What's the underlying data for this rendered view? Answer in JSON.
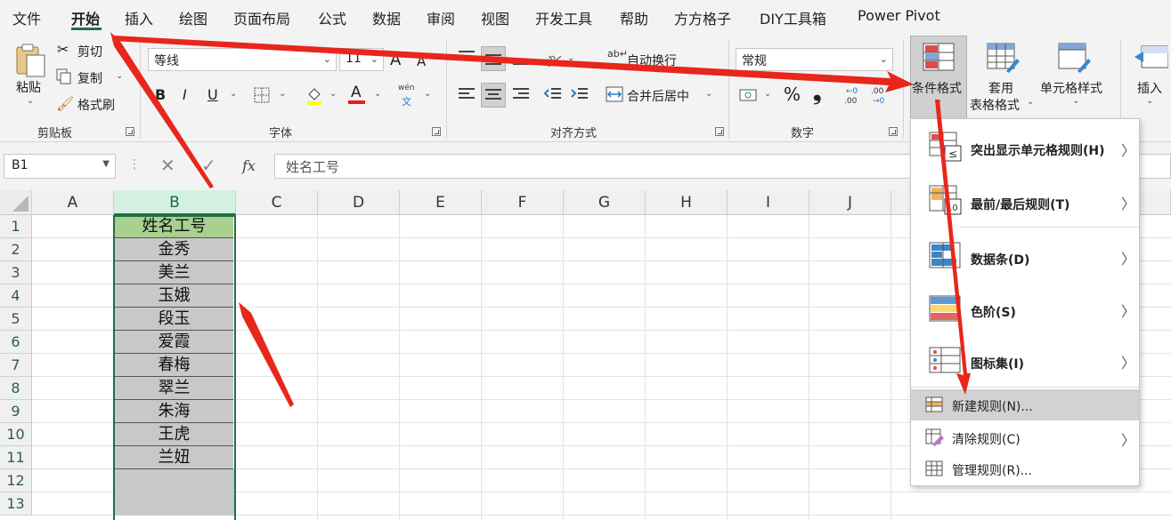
{
  "menu_tabs": [
    "文件",
    "开始",
    "插入",
    "绘图",
    "页面布局",
    "公式",
    "数据",
    "审阅",
    "视图",
    "开发工具",
    "帮助",
    "方方格子",
    "DIY工具箱",
    "Power Pivot"
  ],
  "active_tab": "开始",
  "clipboard": {
    "paste_label": "粘贴",
    "cut_label": "剪切",
    "copy_label": "复制",
    "format_painter_label": "格式刷",
    "group_label": "剪贴板"
  },
  "font": {
    "family": "等线",
    "size": "11",
    "bold": "B",
    "italic": "I",
    "underline": "U",
    "grow": "A",
    "shrink": "A",
    "font_color_glyph": "A",
    "phonetic_top": "wén",
    "phonetic_bottom": "文",
    "group_label": "字体"
  },
  "alignment": {
    "wrap_text_label": "自动换行",
    "merge_label": "合并后居中",
    "group_label": "对齐方式"
  },
  "number": {
    "format": "常规",
    "percent": "%",
    "comma": "❟",
    "group_label": "数字"
  },
  "styles": {
    "conditional_format_label": "条件格式",
    "table_format_label_1": "套用",
    "table_format_label_2": "表格格式",
    "cell_styles_label": "单元格样式"
  },
  "cells": {
    "insert_label": "插入"
  },
  "formula_bar": {
    "name_box": "B1",
    "formula": "姓名工号",
    "fx": "fx"
  },
  "columns": [
    "A",
    "B",
    "C",
    "D",
    "E",
    "F",
    "G",
    "H",
    "I",
    "J"
  ],
  "selected_column": "B",
  "rows": [
    "1",
    "2",
    "3",
    "4",
    "5",
    "6",
    "7",
    "8",
    "9",
    "10",
    "11",
    "12",
    "13"
  ],
  "column_b": [
    "姓名工号",
    "金秀",
    "美兰",
    "玉娥",
    "段玉",
    "爱霞",
    "春梅",
    "翠兰",
    "朱海",
    "王虎",
    "兰妞",
    "",
    ""
  ],
  "cf_menu": {
    "items": [
      {
        "label": "突出显示单元格规则(H)",
        "icon": "highlight-rules-icon",
        "submenu": true
      },
      {
        "label": "最前/最后规则(T)",
        "icon": "top-bottom-rules-icon",
        "submenu": true
      },
      {
        "label": "数据条(D)",
        "icon": "data-bars-icon",
        "submenu": true
      },
      {
        "label": "色阶(S)",
        "icon": "color-scales-icon",
        "submenu": true
      },
      {
        "label": "图标集(I)",
        "icon": "icon-sets-icon",
        "submenu": true
      }
    ],
    "small_items": [
      {
        "label": "新建规则(N)...",
        "icon": "new-rule-icon",
        "submenu": false,
        "highlighted": true
      },
      {
        "label": "清除规则(C)",
        "icon": "clear-rules-icon",
        "submenu": true
      },
      {
        "label": "管理规则(R)...",
        "icon": "manage-rules-icon",
        "submenu": false
      }
    ],
    "icon_glyph_le": "≤",
    "icon_glyph_10": "10"
  },
  "colors": {
    "accent_green": "#1e7145",
    "header_fill": "#a9d08e",
    "data_fill": "#c8c8c8",
    "annotation_red": "#e8261c"
  }
}
